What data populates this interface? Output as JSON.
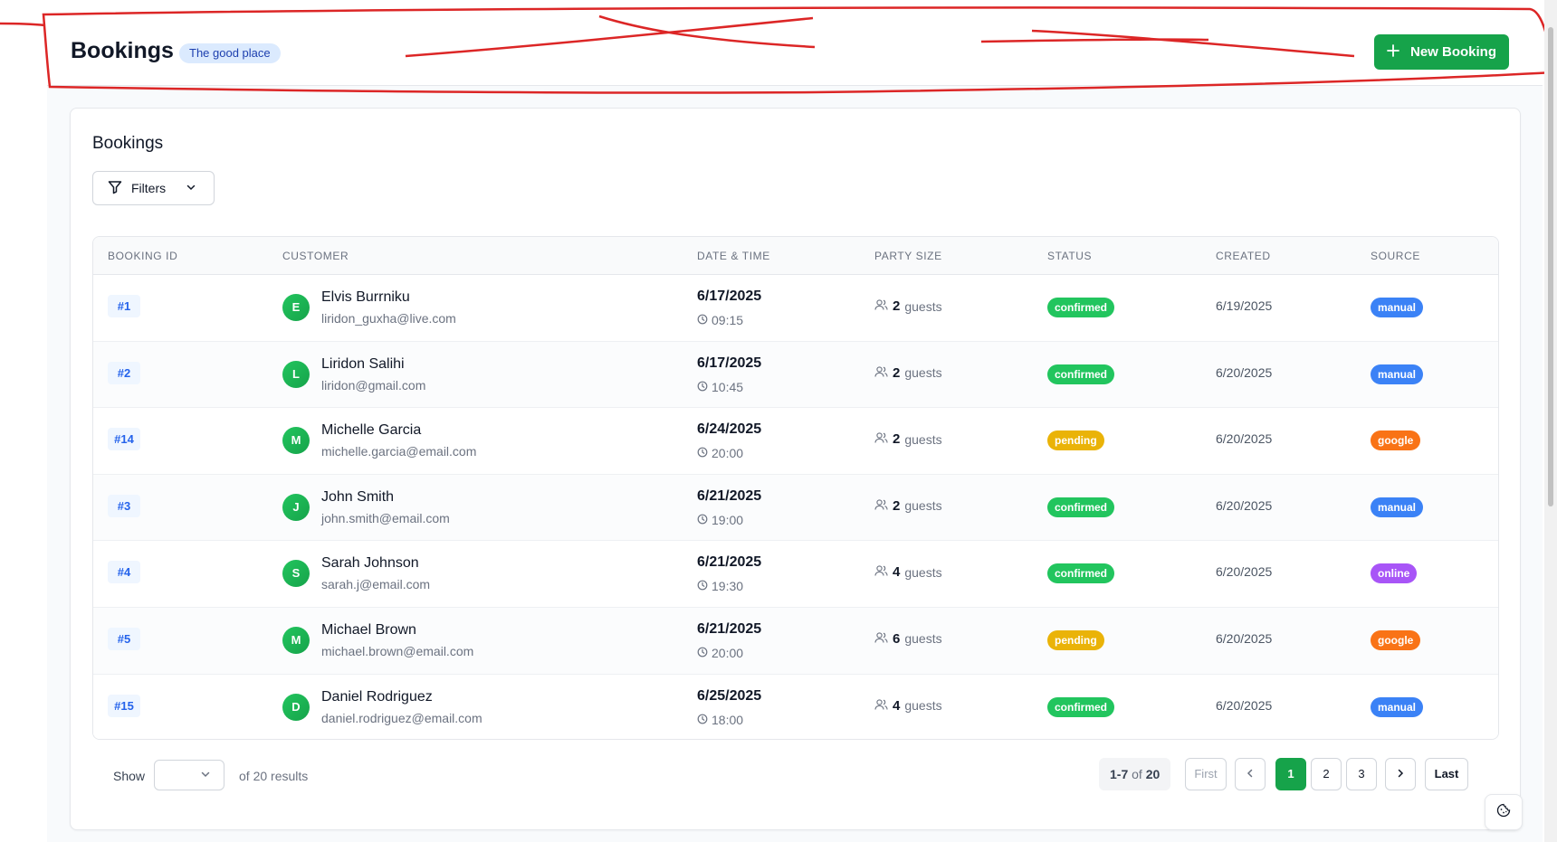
{
  "header": {
    "title": "Bookings",
    "venue_badge": "The good place",
    "new_booking_label": "New Booking"
  },
  "card": {
    "title": "Bookings",
    "filters_label": "Filters"
  },
  "table": {
    "columns": [
      "BOOKING ID",
      "CUSTOMER",
      "DATE & TIME",
      "PARTY SIZE",
      "STATUS",
      "CREATED",
      "SOURCE"
    ],
    "rows": [
      {
        "id": "#1",
        "initial": "E",
        "name": "Elvis Burrniku",
        "email": "liridon_guxha@live.com",
        "date": "6/17/2025",
        "time": "09:15",
        "party": "2",
        "party_unit": "guests",
        "status": "confirmed",
        "created": "6/19/2025",
        "source": "manual"
      },
      {
        "id": "#2",
        "initial": "L",
        "name": "Liridon Salihi",
        "email": "liridon@gmail.com",
        "date": "6/17/2025",
        "time": "10:45",
        "party": "2",
        "party_unit": "guests",
        "status": "confirmed",
        "created": "6/20/2025",
        "source": "manual"
      },
      {
        "id": "#14",
        "initial": "M",
        "name": "Michelle Garcia",
        "email": "michelle.garcia@email.com",
        "date": "6/24/2025",
        "time": "20:00",
        "party": "2",
        "party_unit": "guests",
        "status": "pending",
        "created": "6/20/2025",
        "source": "google"
      },
      {
        "id": "#3",
        "initial": "J",
        "name": "John Smith",
        "email": "john.smith@email.com",
        "date": "6/21/2025",
        "time": "19:00",
        "party": "2",
        "party_unit": "guests",
        "status": "confirmed",
        "created": "6/20/2025",
        "source": "manual"
      },
      {
        "id": "#4",
        "initial": "S",
        "name": "Sarah Johnson",
        "email": "sarah.j@email.com",
        "date": "6/21/2025",
        "time": "19:30",
        "party": "4",
        "party_unit": "guests",
        "status": "confirmed",
        "created": "6/20/2025",
        "source": "online"
      },
      {
        "id": "#5",
        "initial": "M",
        "name": "Michael Brown",
        "email": "michael.brown@email.com",
        "date": "6/21/2025",
        "time": "20:00",
        "party": "6",
        "party_unit": "guests",
        "status": "pending",
        "created": "6/20/2025",
        "source": "google"
      },
      {
        "id": "#15",
        "initial": "D",
        "name": "Daniel Rodriguez",
        "email": "daniel.rodriguez@email.com",
        "date": "6/25/2025",
        "time": "18:00",
        "party": "4",
        "party_unit": "guests",
        "status": "confirmed",
        "created": "6/20/2025",
        "source": "manual"
      }
    ]
  },
  "footer": {
    "show_label": "Show",
    "results_text": "of 20 results",
    "range_text": "1-7",
    "range_of": "of",
    "range_total": "20",
    "first_label": "First",
    "prev_icon": "chevron-left-icon",
    "pages": [
      "1",
      "2",
      "3"
    ],
    "active_page": "1",
    "next_icon": "chevron-right-icon",
    "last_label": "Last"
  },
  "colors": {
    "accent": "#16a34a",
    "status_confirmed": "#22c55e",
    "status_pending": "#eab308",
    "source_manual": "#3b82f6",
    "source_google": "#f97316",
    "source_online": "#a855f7",
    "annotation": "#dc2626"
  }
}
